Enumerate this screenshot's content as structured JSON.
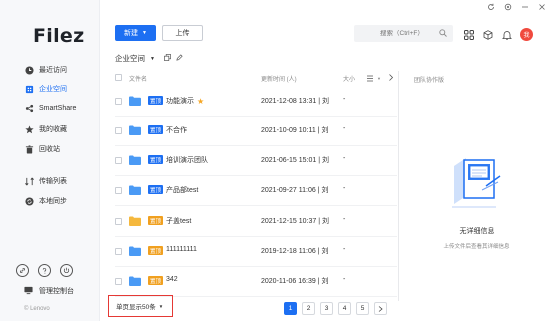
{
  "app": {
    "logo": "Filez",
    "copyright": "© Lenovo"
  },
  "sidebar": {
    "items": [
      {
        "label": "最近访问",
        "icon": "clock-icon"
      },
      {
        "label": "企业空间",
        "icon": "building-icon",
        "active": true
      },
      {
        "label": "SmartShare",
        "icon": "share-icon"
      },
      {
        "label": "我的收藏",
        "icon": "star-icon"
      },
      {
        "label": "回收站",
        "icon": "trash-icon"
      },
      {
        "label": "传输列表",
        "icon": "transfer-icon"
      },
      {
        "label": "本地同步",
        "icon": "sync-icon"
      }
    ],
    "admin_label": "管理控制台"
  },
  "toolbar": {
    "new_label": "新建",
    "upload_label": "上传",
    "search_placeholder": "搜索（Ctrl+F）",
    "avatar_text": "我"
  },
  "breadcrumb": {
    "label": "企业空间"
  },
  "table": {
    "headers": {
      "name": "文件名",
      "time": "更新时间 (人)",
      "size": "大小"
    },
    "rows": [
      {
        "tag": "置顶",
        "tag_color": "#1d6ff2",
        "name": "功能演示",
        "starred": true,
        "time": "2021-12-08 13:31 | 刘",
        "size": "-",
        "folder_color": "#4a9af5"
      },
      {
        "tag": "置顶",
        "tag_color": "#1d6ff2",
        "name": "不合作",
        "starred": false,
        "time": "2021-10-09 10:11 | 刘",
        "size": "-",
        "folder_color": "#4a9af5"
      },
      {
        "tag": "置顶",
        "tag_color": "#1d6ff2",
        "name": "培训演示团队",
        "starred": false,
        "time": "2021-06-15 15:01 | 刘",
        "size": "-",
        "folder_color": "#4a9af5"
      },
      {
        "tag": "置顶",
        "tag_color": "#1d6ff2",
        "name": "产品部test",
        "starred": false,
        "time": "2021-09-27 11:06 | 刘",
        "size": "-",
        "folder_color": "#4a9af5"
      },
      {
        "tag": "置顶",
        "tag_color": "#f0a020",
        "name": "子盖test",
        "starred": false,
        "time": "2021-12-15 10:37 | 刘",
        "size": "-",
        "folder_color": "#f5b83d"
      },
      {
        "tag": "置顶",
        "tag_color": "#f0a020",
        "name": "111111111",
        "starred": false,
        "time": "2019-12-18 11:06 | 刘",
        "size": "-",
        "folder_color": "#4a9af5"
      },
      {
        "tag": "置顶",
        "tag_color": "#f0a020",
        "name": "342",
        "starred": false,
        "time": "2020-11-06 16:39 | 刘",
        "size": "-",
        "folder_color": "#4a9af5"
      }
    ]
  },
  "detail_panel": {
    "title": "团队协作版",
    "empty_title": "无详细信息",
    "empty_hint": "上传文件后查看其详细信息"
  },
  "footer": {
    "page_size_label": "单页显示50条",
    "pages": [
      "1",
      "2",
      "3",
      "4",
      "5"
    ],
    "current_page": "1"
  },
  "colors": {
    "accent": "#1d6ff2",
    "highlight_border": "#e53935"
  }
}
